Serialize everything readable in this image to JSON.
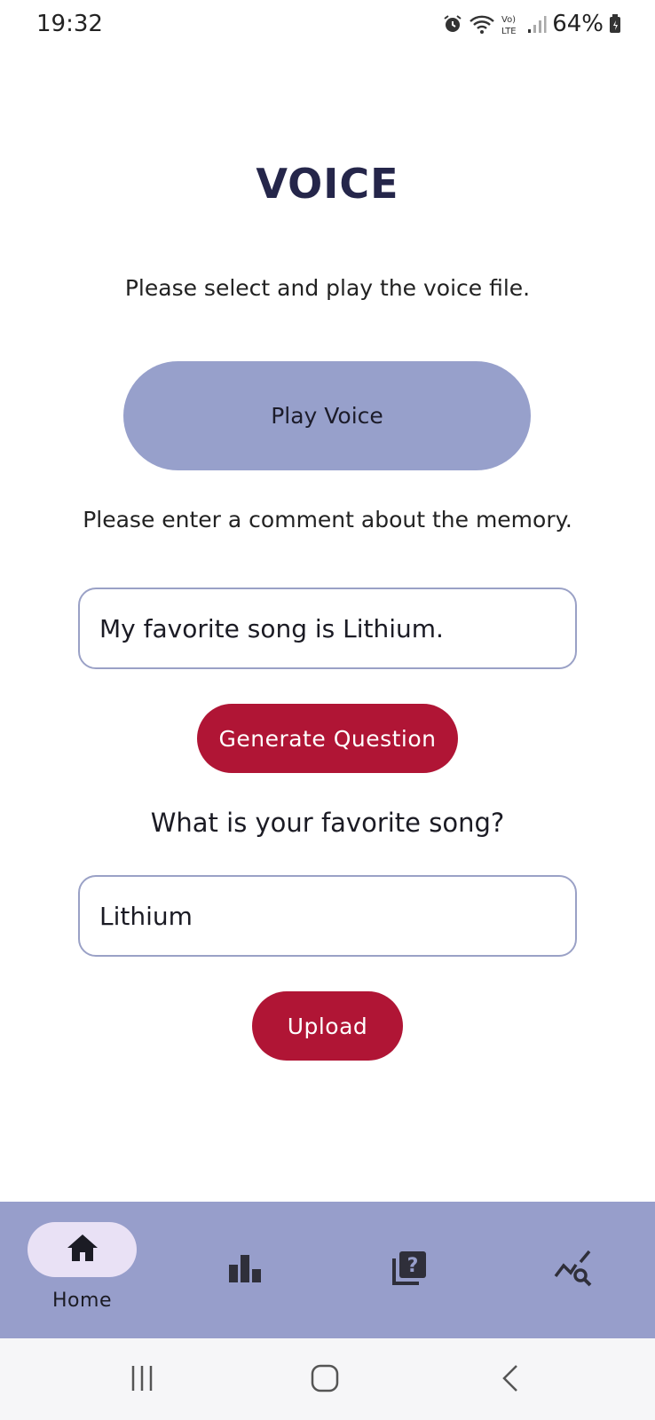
{
  "status_bar": {
    "time": "19:32",
    "battery": "64%",
    "network": "Vo) LTE",
    "icons": [
      "alarm-icon",
      "wifi-icon",
      "signal-icon",
      "battery-icon"
    ]
  },
  "page": {
    "title": "VOICE",
    "instruction_select": "Please select and play the voice file.",
    "play_button_label": "Play Voice",
    "instruction_comment": "Please enter a comment about the memory.",
    "comment_value": "My favorite song is Lithium.",
    "generate_button_label": "Generate Question",
    "question_text": "What is your favorite song?",
    "answer_value": "Lithium",
    "upload_button_label": "Upload"
  },
  "bottom_nav": {
    "items": [
      {
        "label": "Home",
        "icon": "home-icon",
        "active": true
      },
      {
        "label": "",
        "icon": "bar-chart-icon",
        "active": false
      },
      {
        "label": "",
        "icon": "quiz-icon",
        "active": false
      },
      {
        "label": "",
        "icon": "query-stats-icon",
        "active": false
      }
    ]
  },
  "system_nav": {
    "icons": [
      "recent-apps-icon",
      "home-button-icon",
      "back-icon"
    ]
  },
  "colors": {
    "accent_purple": "#979ecb",
    "accent_red": "#b01535",
    "active_pill": "#e9e1f5",
    "title": "#25264a"
  }
}
